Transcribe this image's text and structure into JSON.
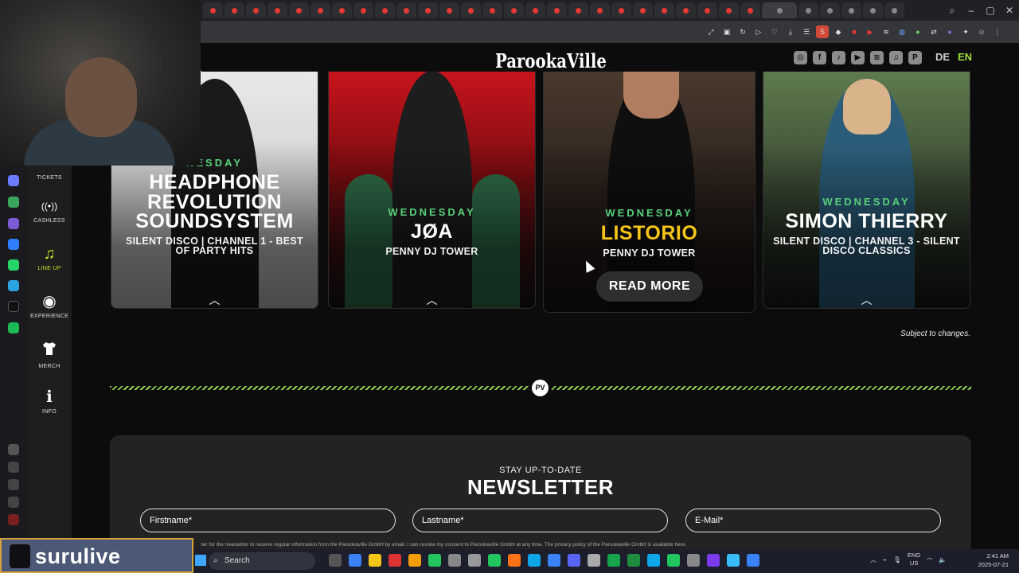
{
  "site": {
    "logo_text": "ParookaVille",
    "lang_de": "DE",
    "lang_en": "EN",
    "social_icons": [
      "instagram-icon",
      "facebook-icon",
      "tiktok-icon",
      "youtube-icon",
      "spotify-icon",
      "apple-music-icon",
      "parookaville-icon"
    ]
  },
  "nav": {
    "items": [
      {
        "label": "TICKETS",
        "icon": "ticket-icon"
      },
      {
        "label": "CASHLESS",
        "icon": "cashless-icon",
        "glyph": "((•))"
      },
      {
        "label": "LINE UP",
        "icon": "music-note-icon",
        "glyph": "♫"
      },
      {
        "label": "EXPERIENCE",
        "icon": "eye-icon",
        "glyph": "◉"
      },
      {
        "label": "MERCH",
        "icon": "shirt-icon",
        "glyph": "👕"
      },
      {
        "label": "INFO",
        "icon": "info-icon",
        "glyph": "ℹ"
      }
    ]
  },
  "cards": [
    {
      "day": "NESDAY",
      "name_l1": "HEADPHONE",
      "name_l2": "REVOLUTION",
      "name_l3": "SOUNDSYSTEM",
      "sub": "SILENT DISCO | CHANNEL 1 - BEST OF PARTY HITS"
    },
    {
      "day": "WEDNESDAY",
      "name": "JØA",
      "sub": "PENNY DJ TOWER"
    },
    {
      "day": "WEDNESDAY",
      "name": "LISTORIO",
      "sub": "PENNY DJ TOWER",
      "button": "READ MORE"
    },
    {
      "day": "WEDNESDAY",
      "name": "SIMON THIERRY",
      "sub": "SILENT DISCO | CHANNEL 3 - SILENT DISCO CLASSICS"
    }
  ],
  "notice": "Subject to changes.",
  "divider_badge": "PV",
  "newsletter": {
    "kicker": "STAY UP-TO-DATE",
    "title": "NEWSLETTER",
    "firstname": "Firstname*",
    "lastname": "Lastname*",
    "email": "E-Mail*",
    "legal": "ter for the newsletter to receive regular information from the Parookaville GmbH by email. I can revoke my consent to Parookaville GmbH at any time. The privacy policy of the Parookaville GmbH is available here."
  },
  "overlay": {
    "streamer": "surulive"
  },
  "taskbar": {
    "search": "Search",
    "lang_top": "ENG",
    "lang_bottom": "US",
    "time": "2:41 AM",
    "date": "2025-07-21"
  },
  "colors": {
    "accent_green": "#58d07a",
    "lineup_yellow": "#c9e42a",
    "name_yellow": "#f5c518",
    "en_green": "#9ddc3a"
  }
}
